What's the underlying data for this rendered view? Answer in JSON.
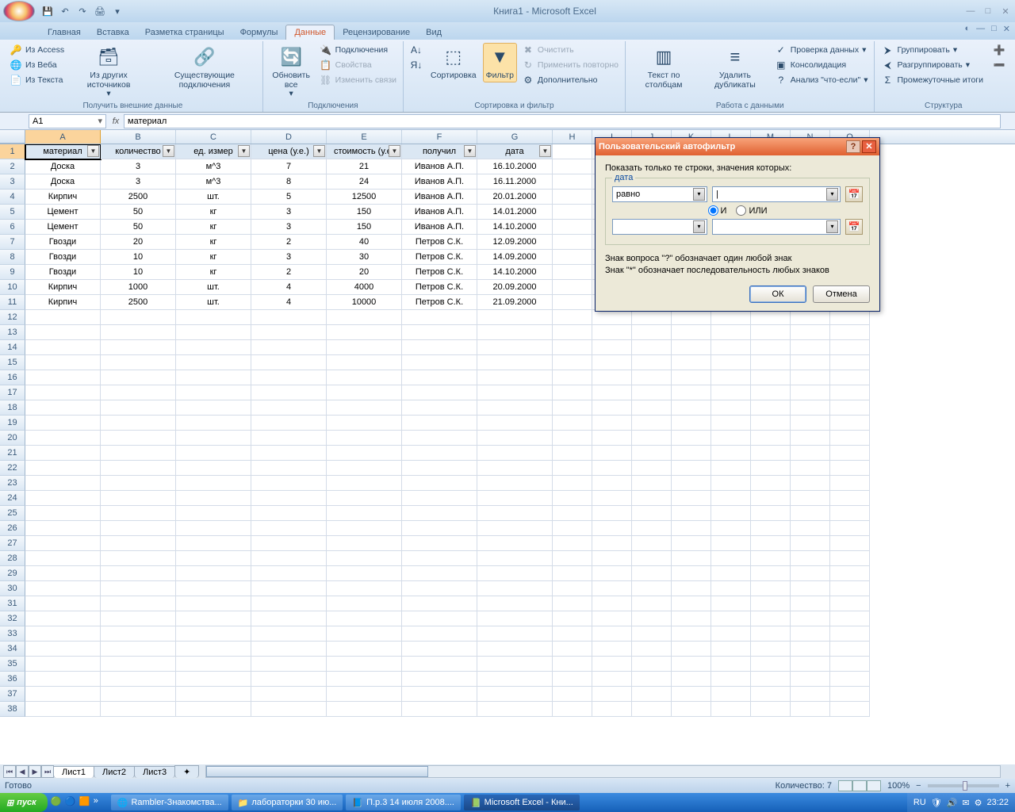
{
  "window": {
    "title": "Книга1 - Microsoft Excel"
  },
  "qat": {
    "save": "save",
    "undo": "undo",
    "redo": "redo",
    "print": "print"
  },
  "tabs": {
    "home": "Главная",
    "insert": "Вставка",
    "layout": "Разметка страницы",
    "formulas": "Формулы",
    "data": "Данные",
    "review": "Рецензирование",
    "view": "Вид"
  },
  "ribbon": {
    "ext": {
      "access": "Из Access",
      "web": "Из Веба",
      "text": "Из Текста",
      "other": "Из других источников",
      "existing": "Существующие подключения",
      "label": "Получить внешние данные"
    },
    "conn": {
      "refresh": "Обновить все",
      "connections": "Подключения",
      "properties": "Свойства",
      "editlinks": "Изменить связи",
      "label": "Подключения"
    },
    "sort": {
      "az": "А↓Я",
      "za": "Я↓А",
      "sort": "Сортировка",
      "filter": "Фильтр",
      "clear": "Очистить",
      "reapply": "Применить повторно",
      "advanced": "Дополнительно",
      "label": "Сортировка и фильтр"
    },
    "tools": {
      "ttc": "Текст по столбцам",
      "dup": "Удалить дубликаты",
      "validate": "Проверка данных",
      "consolidate": "Консолидация",
      "whatif": "Анализ \"что-если\"",
      "label": "Работа с данными"
    },
    "outline": {
      "group": "Группировать",
      "ungroup": "Разгруппировать",
      "subtotal": "Промежуточные итоги",
      "label": "Структура"
    }
  },
  "formula": {
    "name": "A1",
    "value": "материал"
  },
  "columns": [
    "A",
    "B",
    "C",
    "D",
    "E",
    "F",
    "G",
    "H",
    "I",
    "J",
    "K",
    "L",
    "M",
    "N",
    "O"
  ],
  "headers": [
    "материал",
    "количество",
    "ед. измер",
    "цена (у.е.)",
    "стоимость (у.е.",
    "получил",
    "дата"
  ],
  "rows": [
    [
      "Доска",
      "3",
      "м^3",
      "7",
      "21",
      "Иванов А.П.",
      "16.10.2000"
    ],
    [
      "Доска",
      "3",
      "м^3",
      "8",
      "24",
      "Иванов А.П.",
      "16.11.2000"
    ],
    [
      "Кирпич",
      "2500",
      "шт.",
      "5",
      "12500",
      "Иванов А.П.",
      "20.01.2000"
    ],
    [
      "Цемент",
      "50",
      "кг",
      "3",
      "150",
      "Иванов А.П.",
      "14.01.2000"
    ],
    [
      "Цемент",
      "50",
      "кг",
      "3",
      "150",
      "Иванов А.П.",
      "14.10.2000"
    ],
    [
      "Гвозди",
      "20",
      "кг",
      "2",
      "40",
      "Петров С.К.",
      "12.09.2000"
    ],
    [
      "Гвозди",
      "10",
      "кг",
      "3",
      "30",
      "Петров С.К.",
      "14.09.2000"
    ],
    [
      "Гвозди",
      "10",
      "кг",
      "2",
      "20",
      "Петров С.К.",
      "14.10.2000"
    ],
    [
      "Кирпич",
      "1000",
      "шт.",
      "4",
      "4000",
      "Петров С.К.",
      "20.09.2000"
    ],
    [
      "Кирпич",
      "2500",
      "шт.",
      "4",
      "10000",
      "Петров С.К.",
      "21.09.2000"
    ]
  ],
  "sheets": {
    "s1": "Лист1",
    "s2": "Лист2",
    "s3": "Лист3"
  },
  "status": {
    "ready": "Готово",
    "count": "Количество: 7",
    "zoom": "100%"
  },
  "dialog": {
    "title": "Пользовательский автофильтр",
    "prompt": "Показать только те строки, значения которых:",
    "field": "дата",
    "op1": "равно",
    "and": "И",
    "or": "ИЛИ",
    "hint1": "Знак вопроса \"?\" обозначает один любой знак",
    "hint2": "Знак \"*\" обозначает последовательность любых знаков",
    "ok": "ОК",
    "cancel": "Отмена"
  },
  "taskbar": {
    "start": "пуск",
    "t1": "Rambler-Знакомства...",
    "t2": "лабораторки 30 ию...",
    "t3": "П.р.3 14 июля 2008....",
    "t4": "Microsoft Excel - Кни...",
    "lang": "RU",
    "time": "23:22"
  }
}
